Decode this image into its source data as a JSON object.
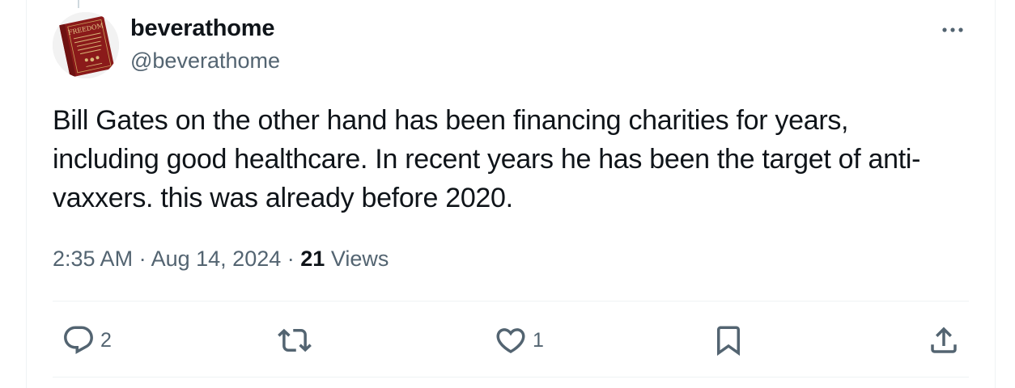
{
  "post": {
    "display_name": "beverathome",
    "handle": "@beverathome",
    "avatar_icon": "book-cover-avatar",
    "avatar_cover_title": "FREEDOM",
    "text_lines": [
      "Bill Gates on the other hand has been financing charities for years,",
      "including good healthcare. In recent years he has been the target of anti-",
      "vaxxers. this was already before 2020."
    ],
    "time": "2:35 AM",
    "date": "Aug 14, 2024",
    "separator": "·",
    "views_count": "21",
    "views_label": "Views"
  },
  "actions": {
    "reply": {
      "icon": "reply-icon",
      "count": "2"
    },
    "repost": {
      "icon": "repost-icon",
      "count": ""
    },
    "like": {
      "icon": "heart-icon",
      "count": "1"
    },
    "bookmark": {
      "icon": "bookmark-icon",
      "count": ""
    },
    "share": {
      "icon": "share-icon",
      "count": ""
    }
  },
  "colors": {
    "text_primary": "#0f1419",
    "text_secondary": "#536471",
    "divider": "#eff3f4",
    "avatar_book": "#8b1a1a"
  }
}
